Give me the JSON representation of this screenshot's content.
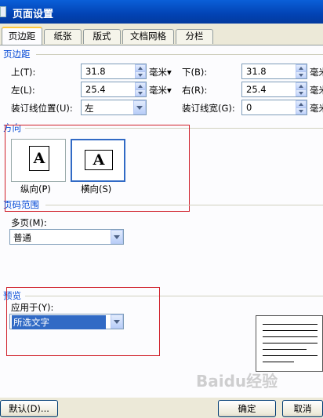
{
  "window": {
    "title": "页面设置"
  },
  "tabs": [
    {
      "label": "页边距"
    },
    {
      "label": "纸张"
    },
    {
      "label": "版式"
    },
    {
      "label": "文档网格"
    },
    {
      "label": "分栏"
    }
  ],
  "margins": {
    "group_title": "页边距",
    "top": {
      "label": "上(T):",
      "value": "31.8",
      "unit": "毫米▾"
    },
    "bottom": {
      "label": "下(B):",
      "value": "31.8",
      "unit": "毫米"
    },
    "left": {
      "label": "左(L):",
      "value": "25.4",
      "unit": "毫米▾"
    },
    "right": {
      "label": "右(R):",
      "value": "25.4",
      "unit": "毫米"
    },
    "gutter_pos": {
      "label": "装订线位置(U):",
      "value": "左"
    },
    "gutter": {
      "label": "装订线宽(G):",
      "value": "0",
      "unit": "毫米"
    }
  },
  "orientation": {
    "group_title": "方向",
    "portrait": {
      "label": "纵向(P)",
      "glyph": "A"
    },
    "landscape": {
      "label": "横向(S)",
      "glyph": "A"
    },
    "selected": "landscape"
  },
  "pages": {
    "group_title": "页码范围",
    "multi_label": "多页(M):",
    "multi_value": "普通"
  },
  "preview": {
    "group_title": "预览",
    "apply_label": "应用于(Y):",
    "apply_value": "所选文字"
  },
  "buttons": {
    "default": "默认(D)...",
    "ok": "确定",
    "cancel": "取消"
  },
  "watermark": "Baidu经验"
}
